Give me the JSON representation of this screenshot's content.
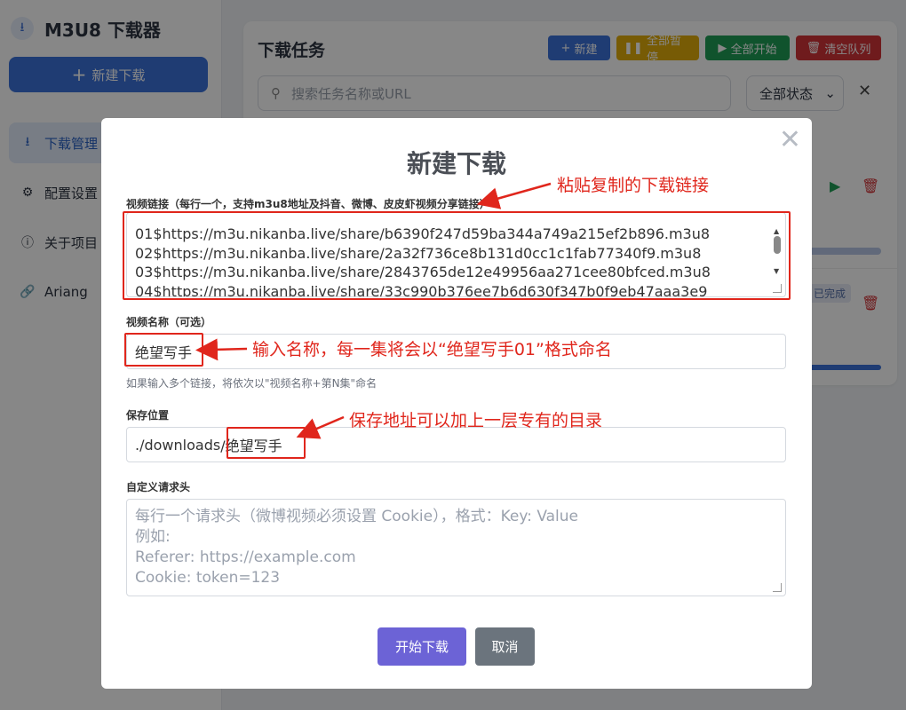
{
  "app": {
    "title": "M3U8 下载器",
    "new_download": "新建下载",
    "nav": [
      {
        "label": "下载管理",
        "icon": "download-icon"
      },
      {
        "label": "配置设置",
        "icon": "gear-icon"
      },
      {
        "label": "关于项目",
        "icon": "info-icon"
      },
      {
        "label": "Ariang",
        "icon": "link-icon"
      }
    ]
  },
  "main": {
    "title": "下载任务",
    "toolbar": {
      "new": "新建",
      "pause_all": "全部暂停",
      "start_all": "全部开始",
      "clear": "清空队列"
    },
    "search_placeholder": "搜索任务名称或URL",
    "status_filter": "全部状态",
    "badge_done": "已完成"
  },
  "modal": {
    "title": "新建下载",
    "urls_label": "视频链接（每行一个，支持m3u8地址及抖音、微博、皮皮虾视频分享链接）",
    "urls": [
      "01$https://m3u.nikanba.live/share/b6390f247d59ba344a749a215ef2b896.m3u8",
      "02$https://m3u.nikanba.live/share/2a32f736ce8b131d0cc1c1fab77340f9.m3u8",
      "03$https://m3u.nikanba.live/share/2843765de12e49956aa271cee80bfced.m3u8",
      "04$https://m3u.nikanba.live/share/33c990b376ee7b6d630f347b0f9eb47aaa3e9"
    ],
    "name_label": "视频名称（可选）",
    "name_value": "绝望写手",
    "name_hint": "如果输入多个链接，将依次以\"视频名称+第N集\"命名",
    "save_label": "保存位置",
    "save_prefix": "./downloads",
    "save_suffix": "/绝望写手",
    "headers_label": "自定义请求头",
    "headers_placeholder": [
      "每行一个请求头（微博视频必须设置 Cookie），格式：Key: Value",
      "例如:",
      "Referer: https://example.com",
      "Cookie: token=123"
    ],
    "start_button": "开始下载",
    "cancel_button": "取消"
  },
  "annotations": {
    "paste_links": "粘贴复制的下载链接",
    "enter_name": "输入名称，每一集将会以“绝望写手01”格式命名",
    "save_dir": "保存地址可以加上一层专有的目录"
  },
  "colors": {
    "primary": "#3b72d9",
    "warning": "#e0ad0b",
    "success": "#1f9d55",
    "danger": "#d13438",
    "annotation": "#e0261c",
    "start_button": "#6c63d6",
    "cancel_button": "#6b747d"
  }
}
